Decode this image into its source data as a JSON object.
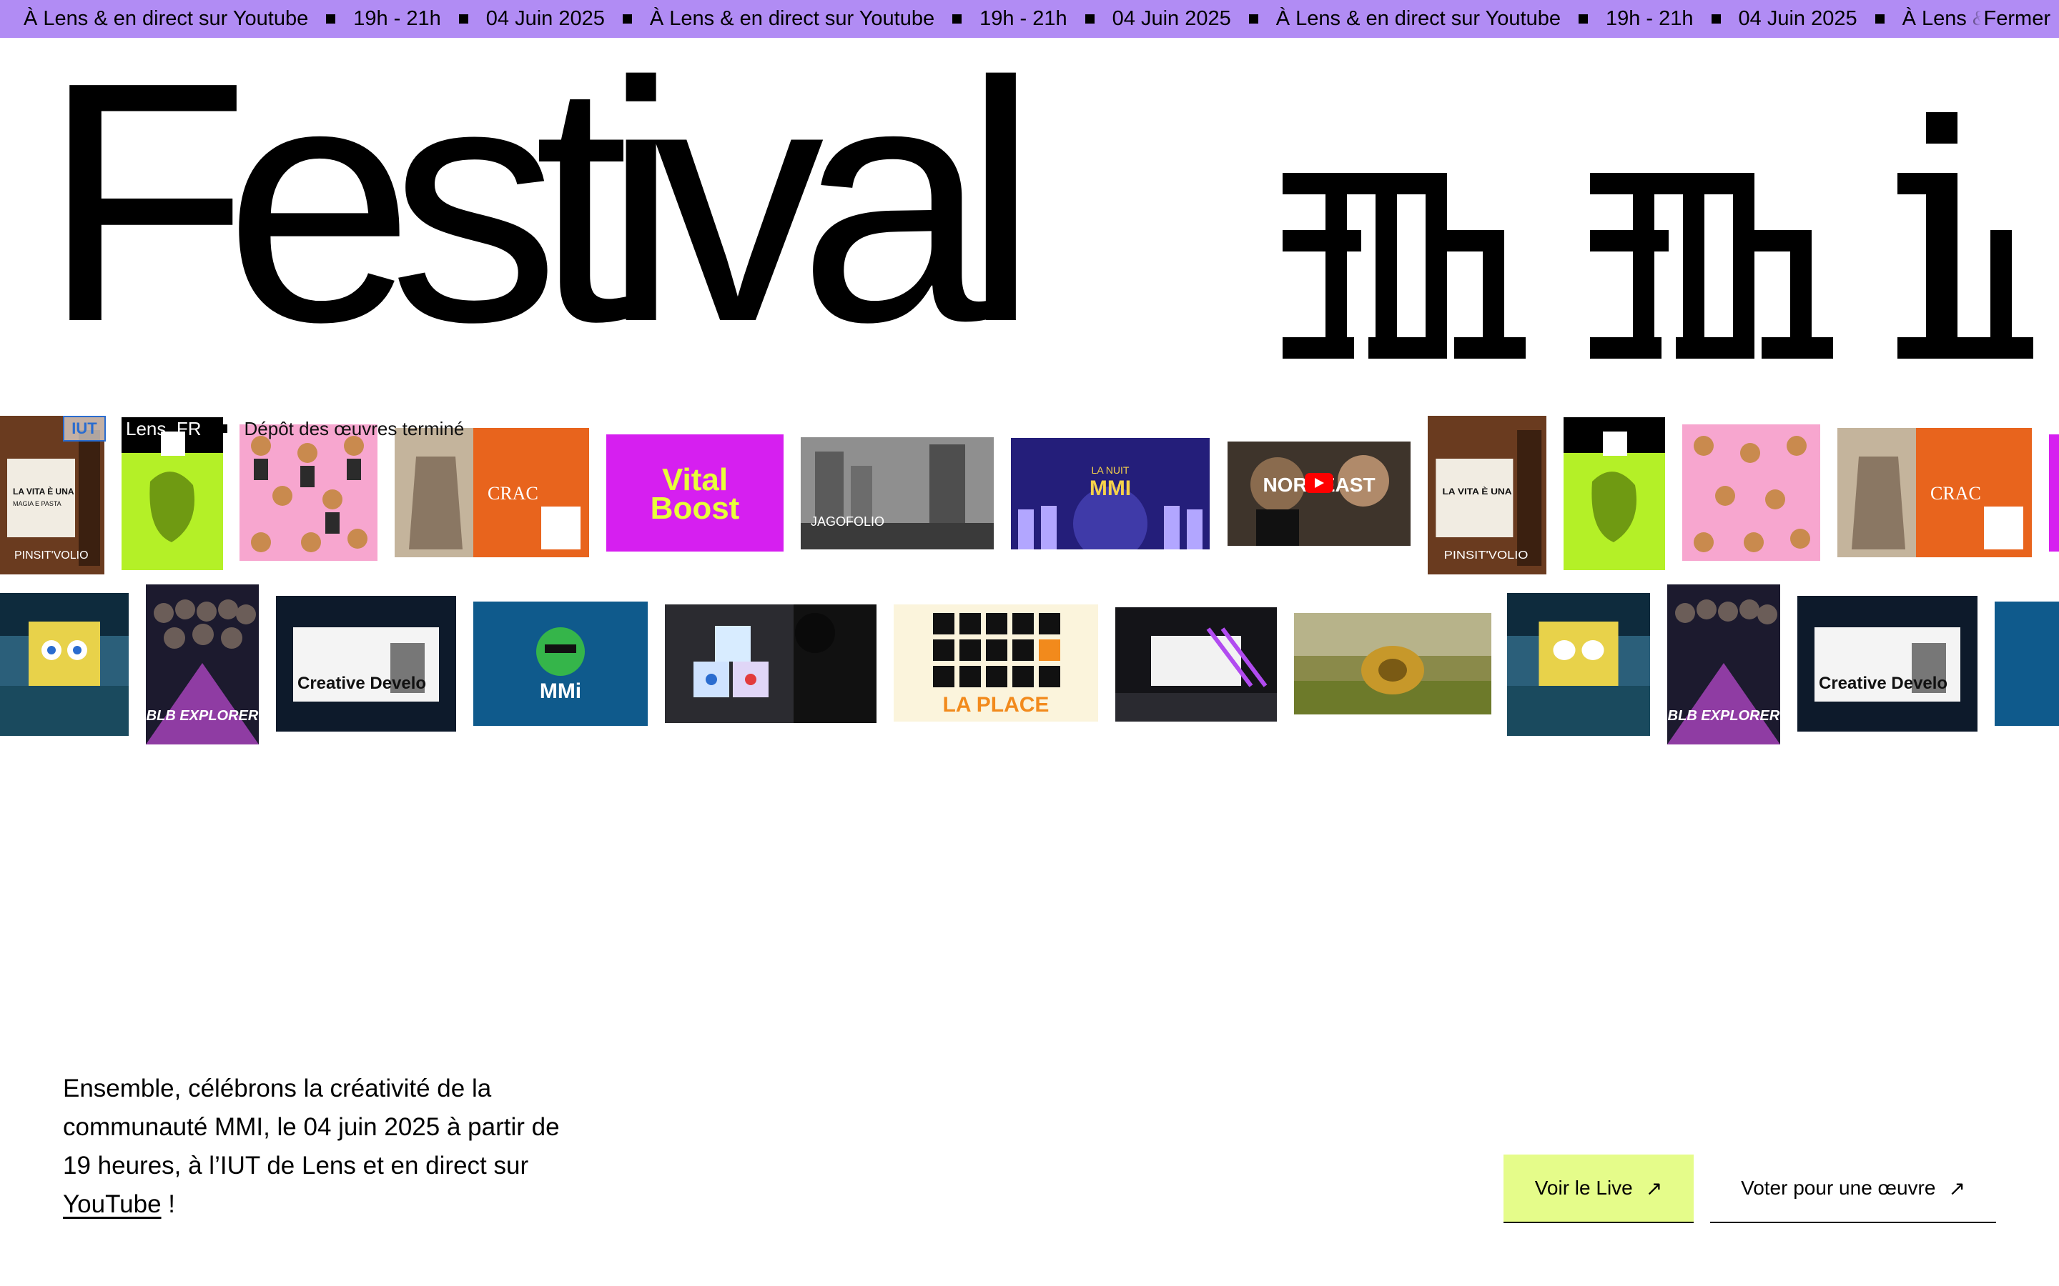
{
  "ticker": {
    "items": [
      "À Lens & en direct sur Youtube",
      "19h - 21h",
      "04 Juin 2025",
      "À Lens & en direct sur Youtube",
      "19h - 21h",
      "04 Juin 2025",
      "À Lens & en direct sur Youtube",
      "19h - 21h",
      "04 Juin 2025",
      "À Lens & en direct sur"
    ],
    "close_label": "Fermer"
  },
  "title": {
    "word": "Festival",
    "logo_name": "mmi"
  },
  "meta": {
    "logo_text": "IUT",
    "city": "Lens, FR",
    "status": "Dépôt des œuvres terminé"
  },
  "gallery": {
    "row1": [
      {
        "name": "vita-poster",
        "caption": "LA VITA È UNA COMBINAZIONE DI MAGIA E PASTA"
      },
      {
        "name": "green-frog-poster",
        "caption": ""
      },
      {
        "name": "pink-pattern",
        "caption": ""
      },
      {
        "name": "crac-orange",
        "caption": "CRAC"
      },
      {
        "name": "vital-boost",
        "caption": "Vital Boost"
      },
      {
        "name": "jagofolio",
        "caption": "JAGOFOLIO"
      },
      {
        "name": "la-nuit-mmi",
        "caption": "LA NUIT MMI"
      },
      {
        "name": "nordeast-video",
        "caption": "NORDEAST"
      }
    ],
    "row2": [
      {
        "name": "spongebob-underwater",
        "caption": ""
      },
      {
        "name": "blb-explorer",
        "caption": "BLB EXPLORER"
      },
      {
        "name": "creative-developer",
        "caption": "Creative Develo"
      },
      {
        "name": "mmi-dino-logo",
        "caption": "MMi"
      },
      {
        "name": "cubes-silhouette",
        "caption": ""
      },
      {
        "name": "la-place",
        "caption": "LA PLACE"
      },
      {
        "name": "neon-room",
        "caption": ""
      },
      {
        "name": "golden-creature",
        "caption": ""
      }
    ]
  },
  "intro": {
    "text_before": "Ensemble, célébrons la créativité de la communauté MMI, le 04 juin 2025 à partir de 19 heures, à l’IUT de Lens et en direct sur ",
    "link": "YouTube",
    "text_after": " !"
  },
  "cta": {
    "live_label": "Voir le Live",
    "vote_label": "Voter pour une œuvre",
    "arrow_icon": "arrow-up-right-icon"
  },
  "colors": {
    "ticker_bg": "#b18cf4",
    "live_button_bg": "#e5fc8a",
    "text": "#000000"
  }
}
